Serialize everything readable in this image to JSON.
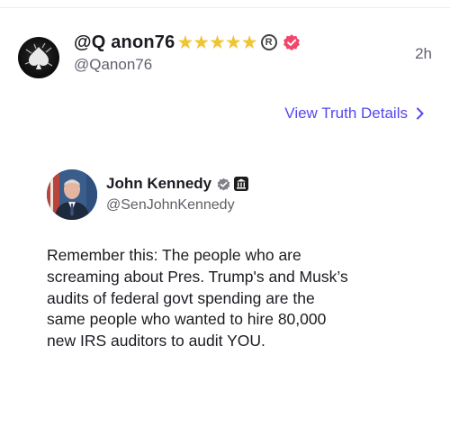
{
  "post": {
    "display_name": "@Q anon76",
    "handle": "@Qanon76",
    "timestamp": "2h",
    "star_count": 5,
    "star_glyph": "★",
    "registered_mark": "R",
    "badge_color": "#f0476a",
    "avatar_icon": "spade-icon"
  },
  "details_link": {
    "label": "View Truth Details",
    "color": "#5448ee"
  },
  "quoted": {
    "name": "John Kennedy",
    "handle": "@SenJohnKennedy",
    "avatar_icon": "portrait",
    "body_lines": [
      "Remember this: The people who are",
      "screaming about Pres. Trump's and Musk’s",
      "audits of federal govt spending are the",
      "same people who wanted to hire 80,000",
      "new IRS auditors to audit YOU."
    ]
  }
}
